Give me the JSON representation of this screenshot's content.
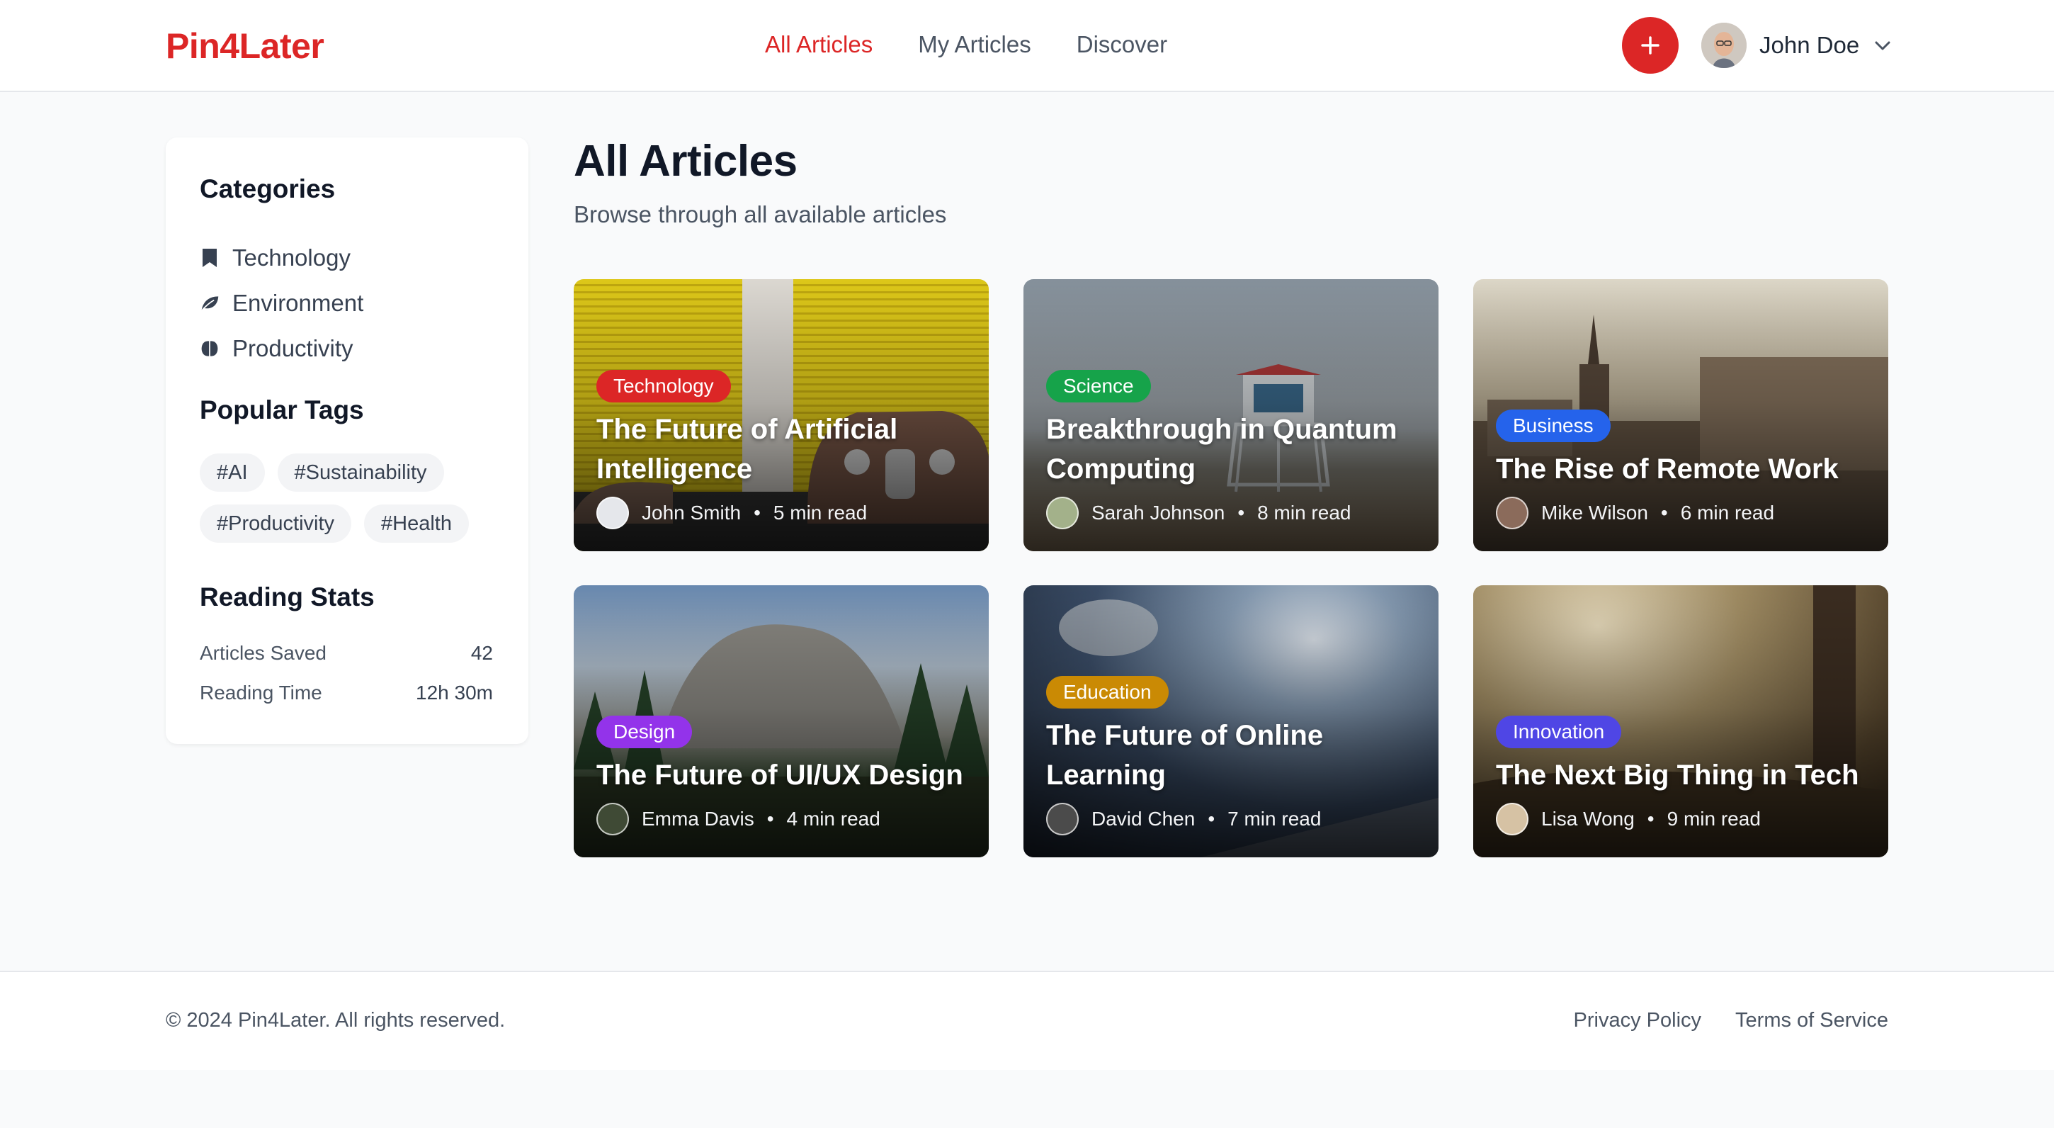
{
  "header": {
    "logo": "Pin4Later",
    "nav": [
      {
        "label": "All Articles",
        "active": true
      },
      {
        "label": "My Articles",
        "active": false
      },
      {
        "label": "Discover",
        "active": false
      }
    ],
    "add_icon": "plus-icon",
    "user": {
      "name": "John Doe",
      "menu_icon": "chevron-down-icon"
    }
  },
  "sidebar": {
    "categories_title": "Categories",
    "categories": [
      {
        "label": "Technology",
        "icon": "bookmark-icon"
      },
      {
        "label": "Environment",
        "icon": "leaf-icon"
      },
      {
        "label": "Productivity",
        "icon": "brain-icon"
      }
    ],
    "tags_title": "Popular Tags",
    "tags": [
      "#AI",
      "#Sustainability",
      "#Productivity",
      "#Health"
    ],
    "stats_title": "Reading Stats",
    "stats": [
      {
        "label": "Articles Saved",
        "value": "42"
      },
      {
        "label": "Reading Time",
        "value": "12h 30m"
      }
    ]
  },
  "main": {
    "title": "All Articles",
    "subtitle": "Browse through all available articles"
  },
  "articles": [
    {
      "category": "Technology",
      "category_color": "#dc2626",
      "title": "The Future of Artificial Intelligence",
      "author": "John Smith",
      "read_time": "5 min read"
    },
    {
      "category": "Science",
      "category_color": "#16a34a",
      "title": "Breakthrough in Quantum Computing",
      "author": "Sarah Johnson",
      "read_time": "8 min read"
    },
    {
      "category": "Business",
      "category_color": "#2563eb",
      "title": "The Rise of Remote Work",
      "author": "Mike Wilson",
      "read_time": "6 min read"
    },
    {
      "category": "Design",
      "category_color": "#9333ea",
      "title": "The Future of UI/UX Design",
      "author": "Emma Davis",
      "read_time": "4 min read"
    },
    {
      "category": "Education",
      "category_color": "#ca8a04",
      "title": "The Future of Online Learning",
      "author": "David Chen",
      "read_time": "7 min read"
    },
    {
      "category": "Innovation",
      "category_color": "#4f46e5",
      "title": "The Next Big Thing in Tech",
      "author": "Lisa Wong",
      "read_time": "9 min read"
    }
  ],
  "footer": {
    "copyright": "© 2024 Pin4Later. All rights reserved.",
    "links": [
      "Privacy Policy",
      "Terms of Service"
    ]
  },
  "colors": {
    "brand": "#dc2626",
    "text_muted": "#4b5563",
    "page_bg": "#f9fafb"
  }
}
